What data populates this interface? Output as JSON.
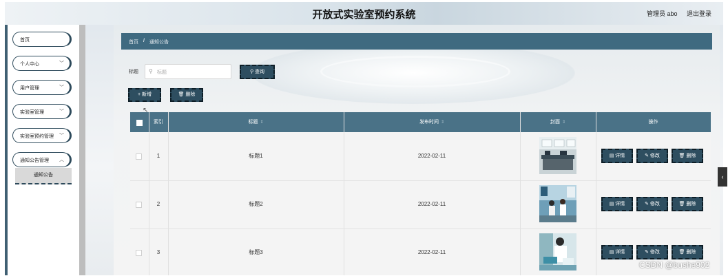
{
  "header": {
    "title": "开放式实验室预约系统",
    "admin_label": "管理员 abo",
    "logout_label": "退出登录"
  },
  "sidebar": {
    "items": [
      {
        "label": "首页",
        "has_arrow": false
      },
      {
        "label": "个人中心",
        "has_arrow": true
      },
      {
        "label": "用户管理",
        "has_arrow": true
      },
      {
        "label": "实验室管理",
        "has_arrow": true
      },
      {
        "label": "实验室预约管理",
        "has_arrow": true
      },
      {
        "label": "通知公告管理",
        "has_arrow": true
      }
    ],
    "sub_item": "通知公告"
  },
  "breadcrumb": {
    "home": "首页",
    "separator": "/",
    "current": "通知公告"
  },
  "filter": {
    "label": "标题",
    "placeholder": "标题",
    "search_button": "查询"
  },
  "actions": {
    "add": "+ 新增",
    "delete": "删除"
  },
  "table": {
    "headers": {
      "index": "索引",
      "title": "标题",
      "publish_time": "发布时间",
      "cover": "封面",
      "operations": "操作"
    },
    "rows": [
      {
        "index": "1",
        "title": "标题1",
        "publish_time": "2022-02-11"
      },
      {
        "index": "2",
        "title": "标题2",
        "publish_time": "2022-02-11"
      },
      {
        "index": "3",
        "title": "标题3",
        "publish_time": "2022-02-11"
      }
    ],
    "row_buttons": {
      "detail": "详情",
      "edit": "修改",
      "delete": "删除"
    }
  },
  "watermark": "CSDN @bushe902",
  "colors": {
    "accent": "#2e4e60",
    "table_header": "#4a7287",
    "breadcrumb": "#3f6a80"
  }
}
